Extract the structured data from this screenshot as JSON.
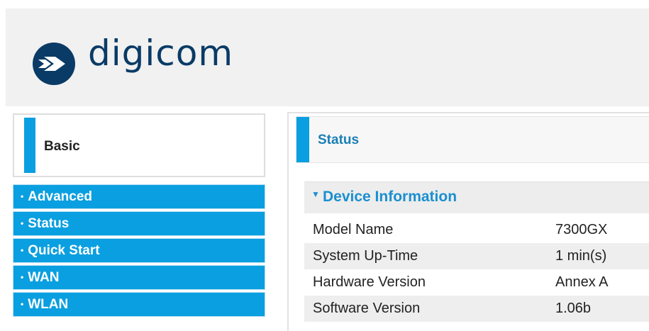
{
  "header": {
    "logo_text": "digicom",
    "logo_icon": "chevron-circle-icon",
    "brand_color": "#0a3b66"
  },
  "sidebar": {
    "basic_label": "Basic",
    "items": [
      {
        "label": "Advanced"
      },
      {
        "label": "Status"
      },
      {
        "label": "Quick Start"
      },
      {
        "label": "WAN"
      },
      {
        "label": "WLAN"
      }
    ],
    "accent_color": "#0a9fe0"
  },
  "main": {
    "title": "Status",
    "section_title": "Device Information",
    "rows": [
      {
        "key": "Model Name",
        "value": "7300GX"
      },
      {
        "key": "System Up-Time",
        "value": "1 min(s)"
      },
      {
        "key": "Hardware Version",
        "value": "Annex A"
      },
      {
        "key": "Software Version",
        "value": "1.06b"
      }
    ]
  }
}
